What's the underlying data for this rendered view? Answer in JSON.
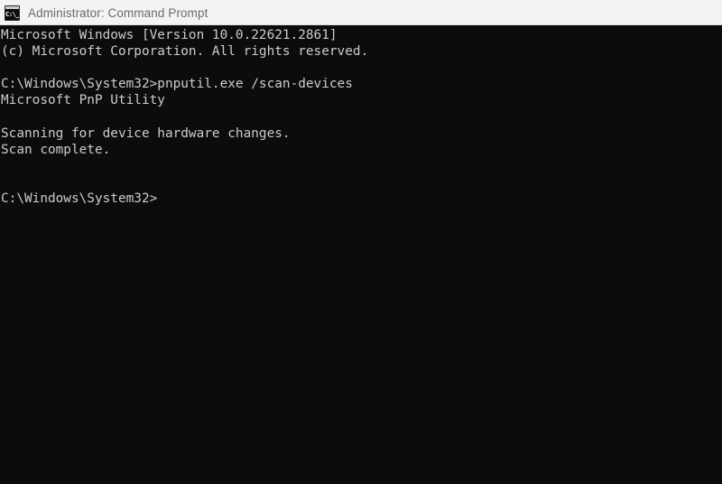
{
  "window": {
    "title": "Administrator: Command Prompt",
    "icon_name": "command-prompt-icon",
    "icon_glyph": "C:\\_",
    "titlebar_bg": "#f3f3f3",
    "titlebar_fg": "#6b6b6b",
    "console_bg": "#0c0c0c",
    "console_fg": "#cccccc"
  },
  "console": {
    "lines": [
      "Microsoft Windows [Version 10.0.22621.2861]",
      "(c) Microsoft Corporation. All rights reserved.",
      "",
      "C:\\Windows\\System32>pnputil.exe /scan-devices",
      "Microsoft PnP Utility",
      "",
      "Scanning for device hardware changes.",
      "Scan complete.",
      "",
      "",
      "C:\\Windows\\System32>"
    ],
    "prompt": "C:\\Windows\\System32>",
    "command": "pnputil.exe /scan-devices"
  }
}
